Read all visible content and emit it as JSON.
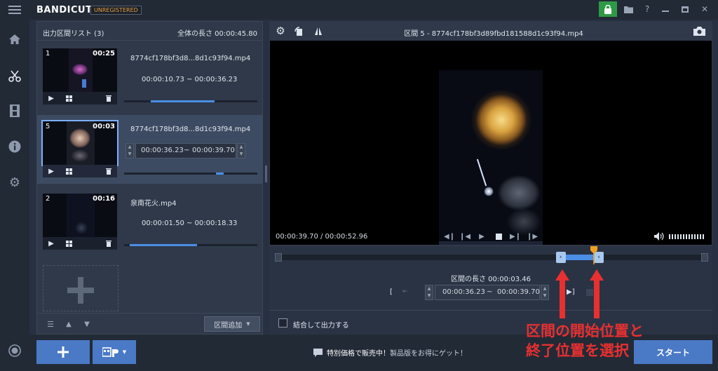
{
  "app": {
    "brand": "BANDICUT",
    "badge": "UNREGISTERED",
    "colors": {
      "accent": "#4b8ee6",
      "marker": "#f0a020",
      "lock": "#2e9a48",
      "annotation": "#e83030"
    }
  },
  "list_panel": {
    "title": "出力区間リスト (3)",
    "total_length": "全体の長さ 00:00:45.80",
    "items": [
      {
        "num": "1",
        "duration": "00:25",
        "filename": "8774cf178bf3d8...8d1c93f94.mp4",
        "range": "00:00:10.73 ~ 00:00:36.23",
        "progress_start": 0.2,
        "progress_end": 0.68
      },
      {
        "num": "5",
        "duration": "00:03",
        "filename": "8774cf178bf3d8...8d1c93f94.mp4",
        "range_start": "00:00:36.23",
        "range_sep": "~",
        "range_end": "00:00:39.70",
        "progress_start": 0.69,
        "progress_end": 0.75
      },
      {
        "num": "2",
        "duration": "00:16",
        "filename": "泉南花火.mp4",
        "range": "00:00:01.50 ~ 00:00:18.33",
        "progress_start": 0.04,
        "progress_end": 0.55
      }
    ],
    "add_section_label": "区間追加"
  },
  "video": {
    "title": "区間 5 - 8774cf178bf3d89fbd181588d1c93f94.mp4",
    "time": "00:00:39.70 / 00:00:52.96",
    "section_length": "区間の長さ 00:00:03.46",
    "range_start": "00:00:36.23",
    "range_sep": "~",
    "range_end": "00:00:39.70",
    "merge_label": "結合して出力する",
    "selection_start": 0.672,
    "selection_end": 0.738
  },
  "bottom": {
    "promo_bold": "特別価格で販売中！",
    "promo_rest": "製品版をお得にゲット！",
    "start_label": "スタート"
  },
  "annotation": {
    "line1": "区間の開始位置と",
    "line2": "終了位置を選択"
  }
}
